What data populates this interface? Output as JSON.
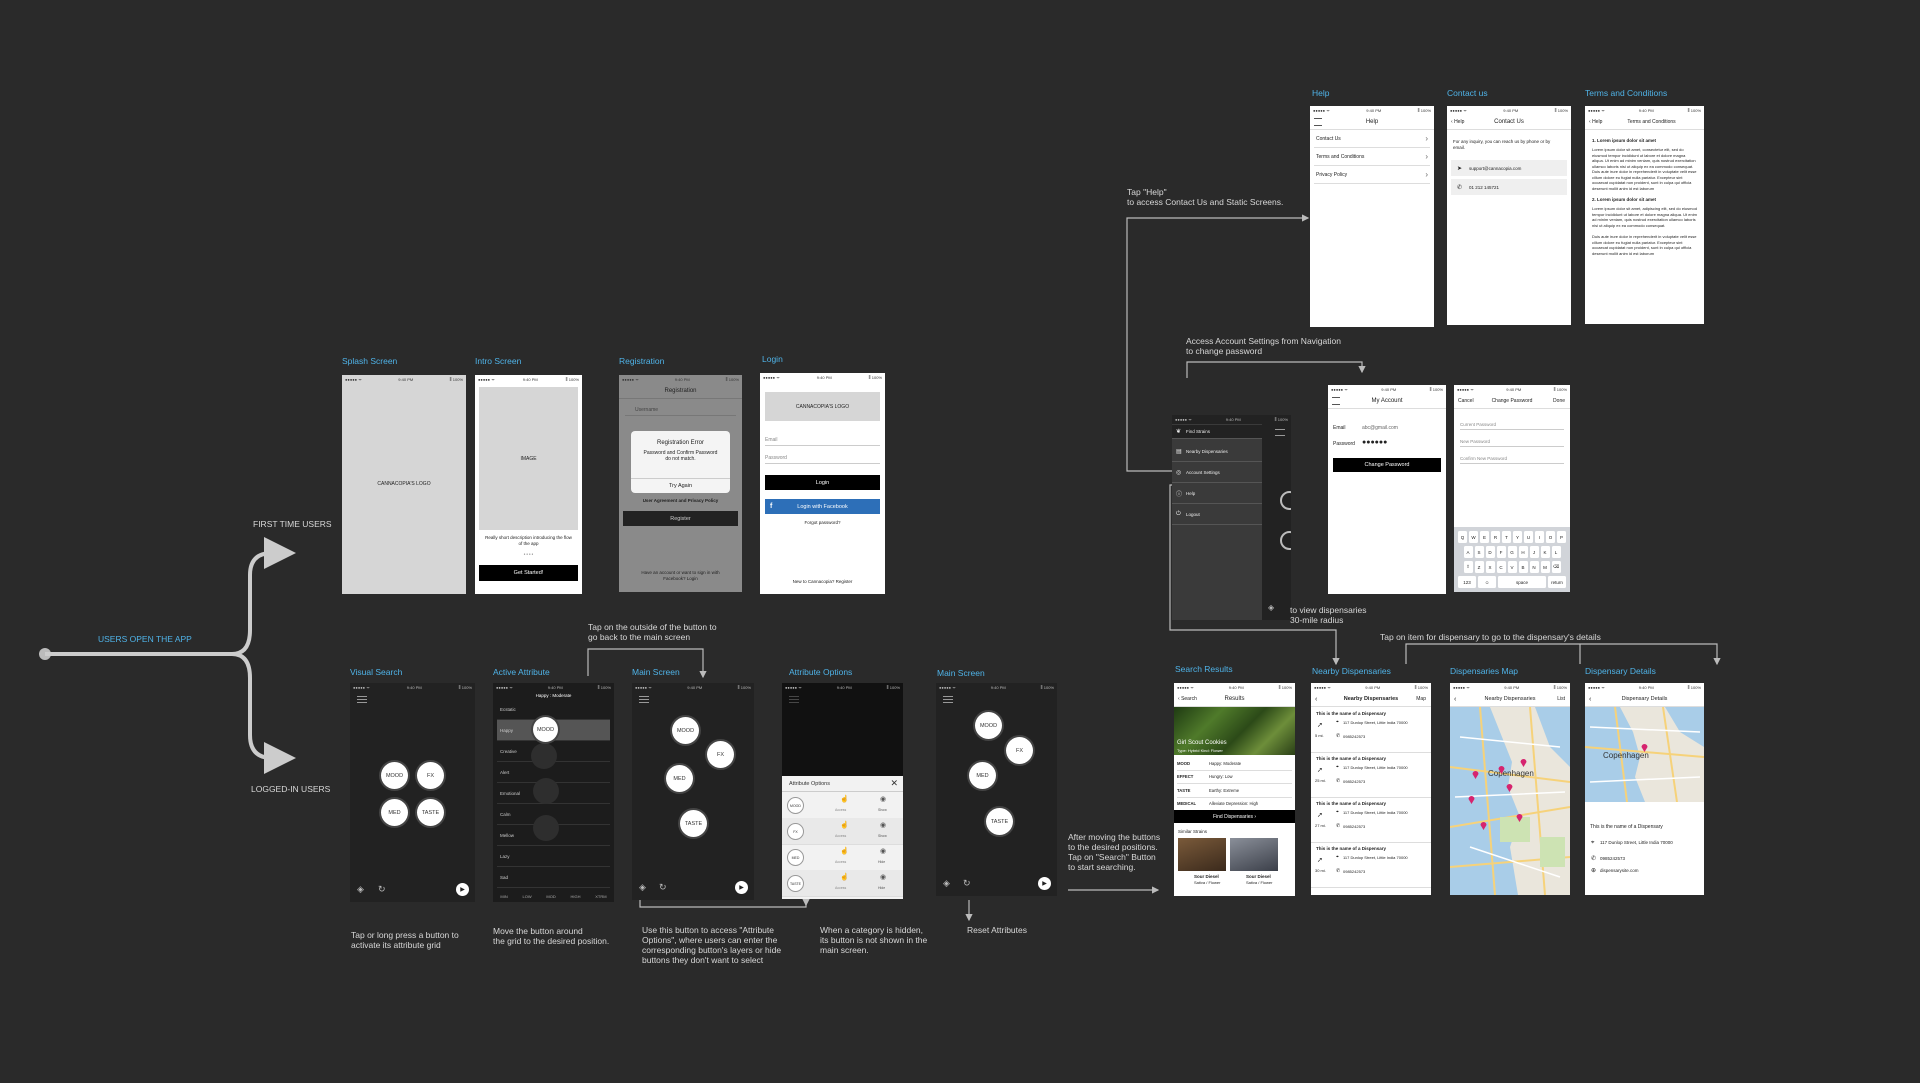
{
  "flow": {
    "start": "USERS OPEN THE APP",
    "first_time": "FIRST TIME USERS",
    "logged_in": "LOGGED-IN USERS"
  },
  "status": {
    "carrier": "●●●●● ᯤ",
    "time": "9:40 PM",
    "battery": "⁑ 100%"
  },
  "screens": {
    "splash": {
      "label": "Splash Screen",
      "logo": "CANNACOPIA'S LOGO"
    },
    "intro": {
      "label": "Intro Screen",
      "image": "IMAGE",
      "desc": "Really short description introducing the flow of the app",
      "dots": "● ● ● ●",
      "cta": "Get Started!"
    },
    "registration": {
      "label": "Registration",
      "title": "Registration",
      "username": "Username",
      "err_title": "Registration Error",
      "err_msg": "Password and Confirm Password do not match.",
      "err_btn": "Try Again",
      "agree": "User Agreement and Privacy Policy",
      "register": "Register",
      "footer": "Have an account or want to sign in with Facebook? Login"
    },
    "login": {
      "label": "Login",
      "logo": "CANNACOPIA'S LOGO",
      "email": "Email",
      "password": "Password",
      "login": "Login",
      "facebook": "Login with Facebook",
      "forgot": "Forgot password?",
      "footer": "New to Cannacopia? Register"
    },
    "visual_search": {
      "label": "Visual Search",
      "mood": "MOOD",
      "fx": "FX",
      "med": "MED",
      "taste": "TASTE"
    },
    "active_attribute": {
      "label": "Active Attribute",
      "header": "Happy : Moderate",
      "rows": [
        "Ecstatic",
        "Happy",
        "Creative",
        "Alert",
        "Emotional",
        "Calm",
        "Mellow",
        "Lazy",
        "Sad"
      ],
      "scale": [
        "MIN",
        "LOW",
        "MOD",
        "HIGH",
        "XTRM"
      ],
      "mood": "MOOD"
    },
    "main1": {
      "label": "Main Screen",
      "mood": "MOOD",
      "fx": "FX",
      "med": "MED",
      "taste": "TASTE"
    },
    "attribute_options": {
      "label": "Attribute Options",
      "title": "Attribute Options",
      "close": "✕",
      "rows": [
        {
          "name": "MOOD",
          "a": "Access",
          "b": "Show"
        },
        {
          "name": "FX",
          "a": "Access",
          "b": "Show"
        },
        {
          "name": "MED",
          "a": "Access",
          "b": "Hide"
        },
        {
          "name": "TASTE",
          "a": "Access",
          "b": "Hide"
        }
      ]
    },
    "main2": {
      "label": "Main Screen",
      "mood": "MOOD",
      "fx": "FX",
      "med": "MED",
      "taste": "TASTE"
    },
    "menu": {
      "items": [
        "Find Strains",
        "Nearby Dispensaries",
        "Account Settings",
        "Help",
        "Logout"
      ]
    },
    "my_account": {
      "title": "My Account",
      "email_k": "Email",
      "email_v": "abc@gmail.com",
      "pass_k": "Password",
      "pass_v": "●●●●●●",
      "btn": "Change Password"
    },
    "change_password": {
      "cancel": "Cancel",
      "title": "Change Password",
      "done": "Done",
      "f1": "Current Password",
      "f2": "New Password",
      "f3": "Confirm New Password",
      "kb1": [
        "Q",
        "W",
        "E",
        "R",
        "T",
        "Y",
        "U",
        "I",
        "O",
        "P"
      ],
      "kb2": [
        "A",
        "S",
        "D",
        "F",
        "G",
        "H",
        "J",
        "K",
        "L"
      ],
      "kb3": [
        "⇧",
        "Z",
        "X",
        "C",
        "V",
        "B",
        "N",
        "M",
        "⌫"
      ],
      "kb4": [
        "123",
        "☺",
        "space",
        "return"
      ]
    },
    "help": {
      "label": "Help",
      "title": "Help",
      "rows": [
        "Contact Us",
        "Terms and Conditions",
        "Privacy Policy"
      ]
    },
    "contact": {
      "label": "Contact us",
      "back": "Help",
      "title": "Contact Us",
      "intro": "For any inquiry, you can reach us by phone or by email.",
      "email": "support@cannacopia.com",
      "phone": "01 212 145721"
    },
    "terms": {
      "label": "Terms and Conditions",
      "back": "Help",
      "title": "Terms and Conditions",
      "h1": "1. Lorem ipsum dolor sit amet",
      "p1": "Lorem ipsum dolor sit amet, consectetur elit, sed do eiusmod tempor incididunt ut labore et dolore magna aliqua. Ut enim ad minim veniam, quis nostrud exercitation ullamco laboris nisi ut aliquip ex ea commodo consequat. Duis aute irure dolor in reprehenderit in voluptate velit esse cillum dolore eu fugiat nulla pariatur. Excepteur sint occaecat cupidatat non proident, sunt in culpa qui officia deserunt mollit anim id est laborum",
      "h2": "2. Lorem ipsum dolor sit amet",
      "p2": "Lorem ipsum dolor sit amet, adipiscing elit, sed do eiusmod tempor incididunt ut labore et dolore magna aliqua. Ut enim ad minim veniam, quis nostrud exercitation ullamco laboris nisi ut aliquip ex ea commodo consequat.",
      "p3": "Duis aute irure dolor in reprehenderit in voluptate velit esse cillum dolore eu fugiat nulla pariatur. Excepteur sint occaecat cupidatat non proident, sunt in culpa qui officia deserunt mollit anim id est laborum"
    },
    "search_results": {
      "label": "Search Results",
      "back": "Search",
      "title": "Results",
      "strain": "Girl Scout Cookies",
      "type": "Type: Hybrid  Kind: Flower",
      "attrs": [
        [
          "MOOD",
          "Happy: Moderate"
        ],
        [
          "EFFECT",
          "Hungry: Low"
        ],
        [
          "TASTE",
          "Earthy: Extreme"
        ],
        [
          "MEDICAL",
          "Alleviate Depression: High"
        ]
      ],
      "find": "Find Dispensaries",
      "similar": "Similar Strains",
      "s1": "Sour Diesel",
      "s1k": "Sativa / Flower",
      "s2": "Sour Diesel",
      "s2k": "Sativa / Flower"
    },
    "nearby": {
      "label": "Nearby Dispensaries",
      "title": "Nearby Dispensaries",
      "map": "Map",
      "items": [
        {
          "name": "This is the name of a Dispensary",
          "dist": "5 mi.",
          "addr": "117 Dunlop Street, Little India 70000",
          "phone": "0985242573"
        },
        {
          "name": "This is the name of a Dispensary",
          "dist": "25 mi.",
          "addr": "117 Dunlop Street, Little India 70000",
          "phone": "0985242573"
        },
        {
          "name": "This is the name of a Dispensary",
          "dist": "27 mi.",
          "addr": "117 Dunlop Street, Little India 70000",
          "phone": "0985242573"
        },
        {
          "name": "This is the name of a Dispensary",
          "dist": "30 mi.",
          "addr": "117 Dunlop Street, Little India 70000",
          "phone": "0985242573"
        }
      ]
    },
    "disp_map": {
      "label": "Dispensaries Map",
      "title": "Nearby Dispensaries",
      "list": "List",
      "city": "Copenhagen"
    },
    "disp_details": {
      "label": "Dispensary Details",
      "title": "Dispensary Details",
      "city": "Copenhagen",
      "name": "This is the name of a Dispensary",
      "addr": "117 Dunlop Street, Little India 70000",
      "phone": "0985242573",
      "site": "dispensarysite.com"
    }
  },
  "notes": {
    "tap_help": "Tap \"Help\"\nto access Contact Us and Static Screens.",
    "account": "Access Account Settings from Navigation\nto change password",
    "view_disp": "to view dispensaries\n30-mile radius",
    "tap_item": "Tap on item for dispensary to go to the dispensary's details",
    "tap_outside": "Tap on the outside of the button to\ngo back to the main screen",
    "tap_long": "Tap or long press a button to\nactivate its attribute grid",
    "move_btn": "Move the button around\nthe grid to the desired position.",
    "use_btn": "Use this button to access \"Attribute\nOptions\", where users can enter the\ncorresponding button's layers or hide\nbuttons they don't want to select",
    "hidden": "When a category is hidden,\nits button is not shown in the\nmain screen.",
    "reset": "Reset Attributes",
    "after_move": "After moving the buttons\nto the desired positions.\nTap on \"Search\" Button\nto start searching."
  }
}
